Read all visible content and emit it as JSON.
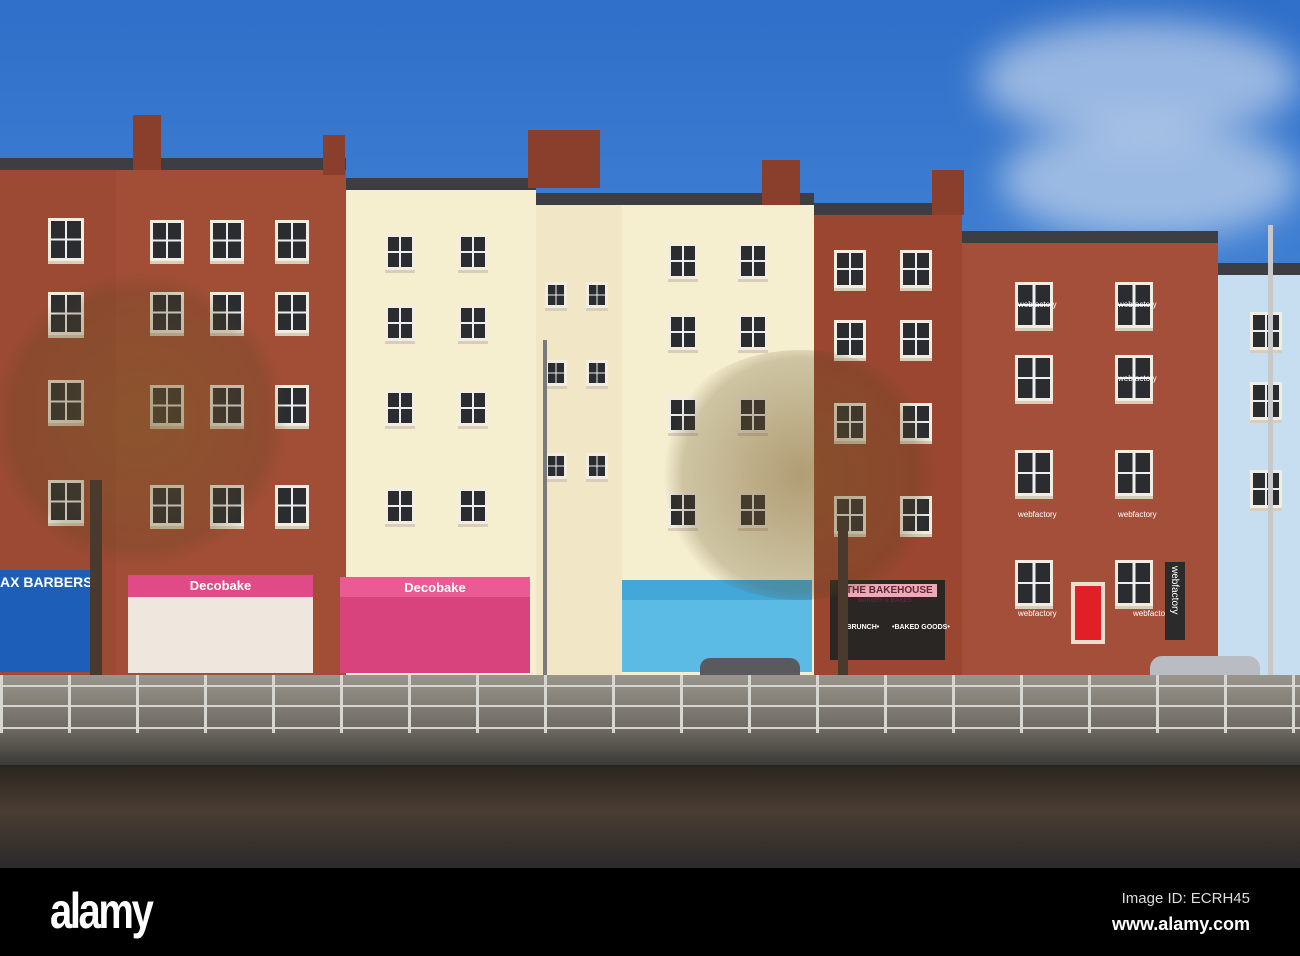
{
  "shops": {
    "barber": "AX BARBERS",
    "decobake_1": "Decobake",
    "decobake_2": "Decobake",
    "bakehouse": "THE BAKEHOUSE",
    "bakehouse_sub": "BAKERY & BAKES",
    "brunch": "•BRUNCH•",
    "baked_goods": "•BAKED GOODS•",
    "webfactory_banner": "webfactory",
    "webfactory_windows": [
      "webfactory",
      "webfactory",
      "webfactory",
      "webfactory",
      "webfactory",
      "webfactory",
      "webfactory"
    ]
  },
  "footer": {
    "logo": "alamy",
    "image_id": "Image ID: ECRH45",
    "url": "www.alamy.com"
  },
  "colors": {
    "sky": "#3f7fd4",
    "brick": "#9c4a34",
    "cream": "#f5efd0",
    "pink_shop": "#e2457f",
    "blue_shop": "#56b8e0",
    "red_door": "#e01f26"
  }
}
